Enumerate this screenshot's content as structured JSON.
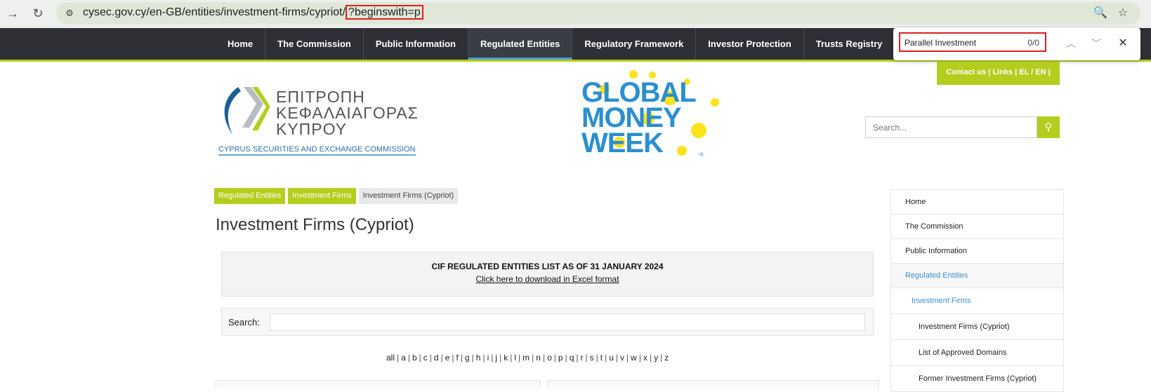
{
  "browser": {
    "url_prefix": "cysec.gov.cy/en-GB/entities/investment-firms/cypriot/",
    "url_query": "?beginswith=p"
  },
  "topnav": {
    "items": [
      "Home",
      "The Commission",
      "Public Information",
      "Regulated Entities",
      "Regulatory Framework",
      "Investor Protection",
      "Trusts Registry"
    ]
  },
  "findbar": {
    "query": "Parallel Investment",
    "count": "0/0"
  },
  "contact": "Contact us  |  Links  |    EL / EN  |",
  "logo": {
    "line1": "ΕΠΙΤΡΟΠΗ",
    "line2": "ΚΕΦΑΛΑΙΑΓΟΡΑΣ",
    "line3": "ΚΥΠΡΟΥ",
    "sub": "CYPRUS SECURITIES AND EXCHANGE COMMISSION"
  },
  "banner": {
    "line1": "GLOBAL",
    "line2": "MONEY",
    "line3": "WEEK",
    "mark": "®"
  },
  "site_search": {
    "placeholder": "Search..."
  },
  "breadcrumb": [
    "Regulated Entities",
    "Investment Firms",
    "Investment Firms (Cypriot)"
  ],
  "page_title": "Investment Firms (Cypriot)",
  "notice": {
    "title": "CIF REGULATED ENTITIES LIST AS OF 31 JANUARY 2024",
    "link": "Click here to download in Excel format"
  },
  "list_search": {
    "label": "Search:"
  },
  "alphabet": [
    "all",
    "a",
    "b",
    "c",
    "d",
    "e",
    "f",
    "g",
    "h",
    "i",
    "j",
    "k",
    "l",
    "m",
    "n",
    "o",
    "p",
    "q",
    "r",
    "s",
    "t",
    "u",
    "v",
    "w",
    "x",
    "y",
    "z"
  ],
  "sidebar": {
    "items": [
      {
        "label": "Home",
        "level": 1
      },
      {
        "label": "The Commission",
        "level": 1
      },
      {
        "label": "Public Information",
        "level": 1
      },
      {
        "label": "Regulated Entities",
        "level": 1
      },
      {
        "label": "Investment Firms",
        "level": 2
      },
      {
        "label": "Investment Firms (Cypriot)",
        "level": 3
      },
      {
        "label": "List of Approved Domains",
        "level": 3
      },
      {
        "label": "Former Investment Firms (Cypriot)",
        "level": 3
      }
    ]
  },
  "colors": {
    "accent_green": "#b5cd1e",
    "nav_dark": "#2e3035",
    "link_blue": "#3b8fd1",
    "find_highlight": "#e02020"
  }
}
